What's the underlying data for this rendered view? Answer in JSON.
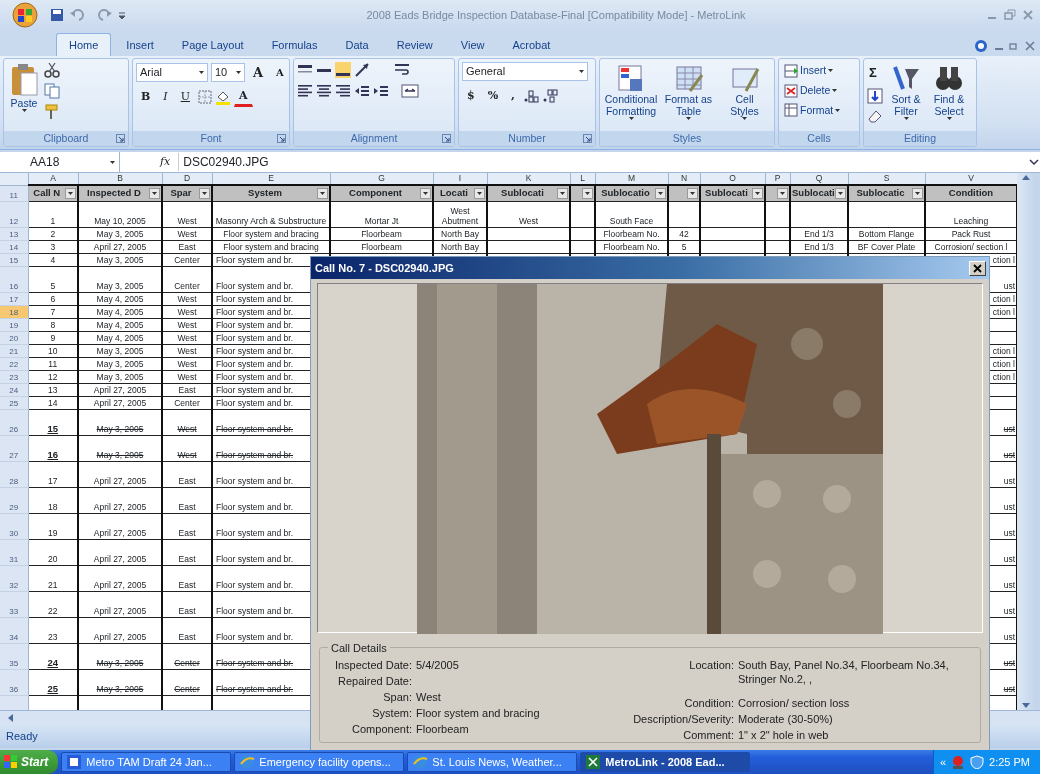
{
  "window": {
    "title": "2008 Eads Bridge Inspection Database-Final  [Compatibility Mode] - MetroLink"
  },
  "ribbon": {
    "tabs": [
      {
        "label": "Home",
        "selected": true
      },
      {
        "label": "Insert",
        "selected": false
      },
      {
        "label": "Page Layout",
        "selected": false
      },
      {
        "label": "Formulas",
        "selected": false
      },
      {
        "label": "Data",
        "selected": false
      },
      {
        "label": "Review",
        "selected": false
      },
      {
        "label": "View",
        "selected": false
      },
      {
        "label": "Acrobat",
        "selected": false
      }
    ],
    "groups": [
      {
        "kind": "clipboard",
        "label": "Clipboard",
        "launcher": true,
        "paste": "Paste"
      },
      {
        "kind": "font",
        "label": "Font",
        "launcher": true,
        "font_name": "Arial",
        "font_size": "10",
        "grow": "A",
        "shrink": "A",
        "styles": [
          "B",
          "I",
          "U"
        ],
        "color_letter": "A"
      },
      {
        "kind": "alignment",
        "label": "Alignment",
        "launcher": true
      },
      {
        "kind": "number",
        "label": "Number",
        "launcher": true,
        "format": "General",
        "symbols": [
          "$",
          "%",
          ","
        ]
      },
      {
        "kind": "styles",
        "label": "Styles",
        "launcher": false,
        "buttons": [
          "Conditional Formatting",
          "Format as Table",
          "Cell Styles"
        ]
      },
      {
        "kind": "cells",
        "label": "Cells",
        "launcher": false,
        "buttons": [
          "Insert",
          "Delete",
          "Format"
        ]
      },
      {
        "kind": "editing",
        "label": "Editing",
        "launcher": false,
        "sum": "Σ",
        "buttons": [
          "Sort & Filter",
          "Find & Select"
        ]
      }
    ]
  },
  "formula_bar": {
    "name_box": "AA18",
    "fx": "fx",
    "value": "DSC02940.JPG"
  },
  "sheet": {
    "header_row": "11",
    "columns": [
      {
        "letter": "A",
        "header": "Call N",
        "filter": true
      },
      {
        "letter": "B",
        "header": "Inspected D",
        "filter": true
      },
      {
        "letter": "D",
        "header": "Spar",
        "filter": true
      },
      {
        "letter": "E",
        "header": "System",
        "filter": true
      },
      {
        "letter": "G",
        "header": "Component",
        "filter": true
      },
      {
        "letter": "I",
        "header": "Locati",
        "filter": true
      },
      {
        "letter": "K",
        "header": "Sublocati",
        "filter": true
      },
      {
        "letter": "L",
        "filter": true
      },
      {
        "letter": "M",
        "header": "Sublocatio",
        "filter": true
      },
      {
        "letter": "N",
        "filter": true
      },
      {
        "letter": "O",
        "header": "Sublocati",
        "filter": true
      },
      {
        "letter": "P",
        "filter": true
      },
      {
        "letter": "Q",
        "header": "Sublocati",
        "filter": true
      },
      {
        "letter": "S",
        "header": "Sublocatic",
        "filter": true
      },
      {
        "letter": "V",
        "header": "Condition",
        "filter": false
      }
    ],
    "rows": [
      {
        "number": "12",
        "selected": false,
        "struck": false,
        "tall": true,
        "cells": {
          "A": "1",
          "B": "May 10, 2005",
          "D": "West",
          "E": "Masonry Arch & Substructure",
          "G": "Mortar Jt",
          "I": "West Abutment",
          "K": "West",
          "M": "South Face",
          "V": "Leaching"
        }
      },
      {
        "number": "13",
        "selected": false,
        "struck": false,
        "tall": false,
        "cells": {
          "A": "2",
          "B": "May 3, 2005",
          "D": "West",
          "E": "Floor system and bracing",
          "G": "Floorbeam",
          "I": "North Bay",
          "M": "Floorbeam No.",
          "N": "42",
          "Q": "End 1/3",
          "S": "Bottom Flange",
          "V": "Pack Rust"
        }
      },
      {
        "number": "14",
        "selected": false,
        "struck": false,
        "tall": false,
        "cells": {
          "A": "3",
          "B": "April 27, 2005",
          "D": "East",
          "E": "Floor system and bracing",
          "G": "Floorbeam",
          "I": "North Bay",
          "M": "Floorbeam No.",
          "N": "5",
          "Q": "End 1/3",
          "S": "BF Cover Plate",
          "V": "Corrosion/ section l"
        }
      },
      {
        "number": "15",
        "selected": false,
        "struck": false,
        "tall": false,
        "cells": {
          "A": "4",
          "B": "May 3, 2005",
          "D": "Center",
          "E": "Floor system and br.",
          "V": "ction l"
        }
      },
      {
        "number": "16",
        "selected": false,
        "struck": false,
        "tall": true,
        "cells": {
          "A": "5",
          "B": "May 3, 2005",
          "D": "Center",
          "E": "Floor system and br.",
          "V": "ust"
        }
      },
      {
        "number": "17",
        "selected": false,
        "struck": false,
        "tall": false,
        "cells": {
          "A": "6",
          "B": "May 4, 2005",
          "D": "West",
          "E": "Floor system and br.",
          "V": "ction l"
        }
      },
      {
        "number": "18",
        "selected": true,
        "struck": false,
        "tall": false,
        "cells": {
          "A": "7",
          "B": "May 4, 2005",
          "D": "West",
          "E": "Floor system and br.",
          "V": "ction l"
        }
      },
      {
        "number": "19",
        "selected": false,
        "struck": false,
        "tall": false,
        "cells": {
          "A": "8",
          "B": "May 4, 2005",
          "D": "West",
          "E": "Floor system and br."
        }
      },
      {
        "number": "20",
        "selected": false,
        "struck": false,
        "tall": false,
        "cells": {
          "A": "9",
          "B": "May 4, 2005",
          "D": "West",
          "E": "Floor system and br."
        }
      },
      {
        "number": "21",
        "selected": false,
        "struck": false,
        "tall": false,
        "cells": {
          "A": "10",
          "B": "May 3, 2005",
          "D": "West",
          "E": "Floor system and br.",
          "V": "ction l"
        }
      },
      {
        "number": "22",
        "selected": false,
        "struck": false,
        "tall": false,
        "cells": {
          "A": "11",
          "B": "May 3, 2005",
          "D": "West",
          "E": "Floor system and br.",
          "V": "ction l"
        }
      },
      {
        "number": "23",
        "selected": false,
        "struck": false,
        "tall": false,
        "cells": {
          "A": "12",
          "B": "May 3, 2005",
          "D": "West",
          "E": "Floor system and br.",
          "V": "ction l"
        }
      },
      {
        "number": "24",
        "selected": false,
        "struck": false,
        "tall": false,
        "cells": {
          "A": "13",
          "B": "April 27, 2005",
          "D": "East",
          "E": "Floor system and br."
        }
      },
      {
        "number": "25",
        "selected": false,
        "struck": false,
        "tall": false,
        "cells": {
          "A": "14",
          "B": "April 27, 2005",
          "D": "Center",
          "E": "Floor system and br."
        }
      },
      {
        "number": "26",
        "selected": false,
        "struck": true,
        "tall": true,
        "cells": {
          "A": "15",
          "B": "May 3, 2005",
          "D": "West",
          "E": "Floor system and br.",
          "V": "ust"
        }
      },
      {
        "number": "27",
        "selected": false,
        "struck": true,
        "tall": true,
        "cells": {
          "A": "16",
          "B": "May 3, 2005",
          "D": "West",
          "E": "Floor system and br.",
          "V": "ust"
        }
      },
      {
        "number": "28",
        "selected": false,
        "struck": false,
        "tall": true,
        "cells": {
          "A": "17",
          "B": "April 27, 2005",
          "D": "East",
          "E": "Floor system and br.",
          "V": "ust"
        }
      },
      {
        "number": "29",
        "selected": false,
        "struck": false,
        "tall": true,
        "cells": {
          "A": "18",
          "B": "April 27, 2005",
          "D": "East",
          "E": "Floor system and br.",
          "V": "ust"
        }
      },
      {
        "number": "30",
        "selected": false,
        "struck": false,
        "tall": true,
        "cells": {
          "A": "19",
          "B": "April 27, 2005",
          "D": "East",
          "E": "Floor system and br.",
          "V": "ust"
        }
      },
      {
        "number": "31",
        "selected": false,
        "struck": false,
        "tall": true,
        "cells": {
          "A": "20",
          "B": "April 27, 2005",
          "D": "East",
          "E": "Floor system and br.",
          "V": "ust"
        }
      },
      {
        "number": "32",
        "selected": false,
        "struck": false,
        "tall": true,
        "cells": {
          "A": "21",
          "B": "April 27, 2005",
          "D": "East",
          "E": "Floor system and br.",
          "V": "ust"
        }
      },
      {
        "number": "33",
        "selected": false,
        "struck": false,
        "tall": true,
        "cells": {
          "A": "22",
          "B": "April 27, 2005",
          "D": "East",
          "E": "Floor system and br.",
          "V": "ust"
        }
      },
      {
        "number": "34",
        "selected": false,
        "struck": false,
        "tall": true,
        "cells": {
          "A": "23",
          "B": "April 27, 2005",
          "D": "East",
          "E": "Floor system and br.",
          "V": "ust"
        }
      },
      {
        "number": "35",
        "selected": false,
        "struck": true,
        "tall": true,
        "cells": {
          "A": "24",
          "B": "May 3, 2005",
          "D": "Center",
          "E": "Floor system and br.",
          "V": "ust"
        }
      },
      {
        "number": "36",
        "selected": false,
        "struck": true,
        "tall": true,
        "cells": {
          "A": "25",
          "B": "May 3, 2005",
          "D": "Center",
          "E": "Floor system and br.",
          "V": "ust"
        }
      }
    ],
    "status": "Ready"
  },
  "dialog": {
    "title": "Call No. 7 - DSC02940.JPG",
    "details_title": "Call Details",
    "left_fields": [
      {
        "label": "Inspected Date:",
        "value": "5/4/2005"
      },
      {
        "label": "Repaired Date:"
      },
      {
        "label": "Span:",
        "value": "West"
      },
      {
        "label": "System:",
        "value": "Floor system and bracing"
      },
      {
        "label": "Component:",
        "value": "Floorbeam"
      }
    ],
    "right_fields": [
      {
        "label": "Location:",
        "value": "South Bay, Panel No.34, Floorbeam No.34, Stringer No.2, ,"
      },
      {
        "label": "Condition:",
        "value": "Corrosion/ section loss"
      },
      {
        "label": "Description/Severity:",
        "value": "Moderate (30-50%)"
      },
      {
        "label": "Comment:",
        "value": "1\" x 2\" hole in web"
      }
    ]
  },
  "taskbar": {
    "start": "Start",
    "items": [
      {
        "label": "Metro TAM Draft 24 Jan...",
        "kind": "word",
        "selected": false
      },
      {
        "label": "Emergency facility opens...",
        "kind": "browser",
        "selected": false
      },
      {
        "label": "St. Louis News, Weather...",
        "kind": "browser",
        "selected": false
      },
      {
        "label": "MetroLink - 2008 Ead...",
        "kind": "excel",
        "selected": true
      }
    ],
    "tray_toggle": "«",
    "clock": "2:25 PM"
  }
}
